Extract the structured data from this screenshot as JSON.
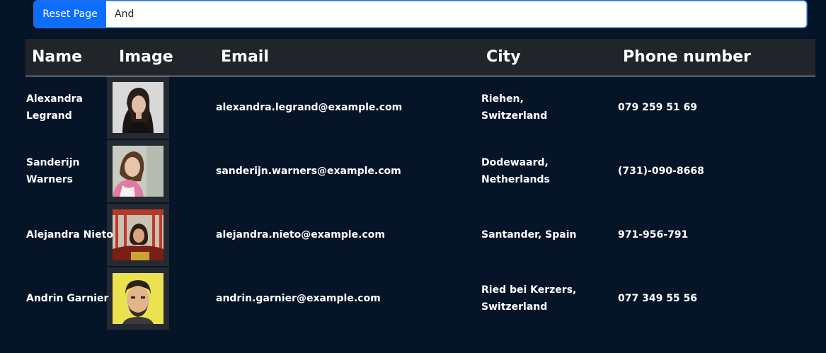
{
  "search": {
    "reset_label": "Reset Page",
    "value": "And"
  },
  "table": {
    "headers": {
      "name": "Name",
      "image": "Image",
      "email": "Email",
      "city": "City",
      "phone": "Phone number"
    },
    "rows": [
      {
        "name": "Alexandra Legrand",
        "image": "portrait-photo",
        "email": "alexandra.legrand@example.com",
        "city": "Riehen, Switzerland",
        "phone": "079 259 51 69"
      },
      {
        "name": "Sanderijn Warners",
        "image": "portrait-photo",
        "email": "sanderijn.warners@example.com",
        "city": "Dodewaard, Netherlands",
        "phone": "(731)-090-8668"
      },
      {
        "name": "Alejandra Nieto",
        "image": "portrait-photo",
        "email": "alejandra.nieto@example.com",
        "city": "Santander, Spain",
        "phone": "971-956-791"
      },
      {
        "name": "Andrin Garnier",
        "image": "portrait-photo",
        "email": "andrin.garnier@example.com",
        "city": "Ried bei Kerzers, Switzerland",
        "phone": "077 349 55 56"
      }
    ]
  },
  "colors": {
    "background": "#061427",
    "header_background": "#212529",
    "primary_button": "#0d6efd",
    "text": "#ffffff"
  }
}
